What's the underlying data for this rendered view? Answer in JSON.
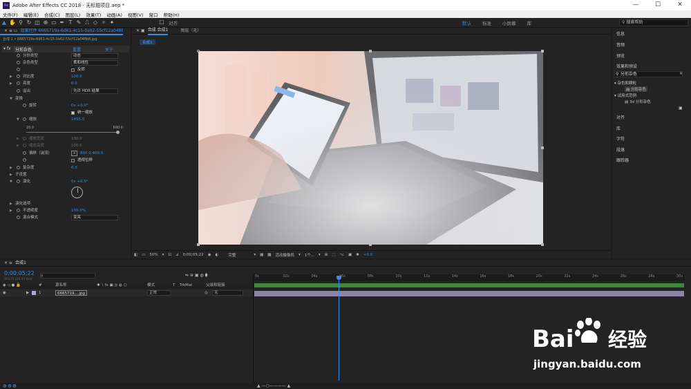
{
  "app": {
    "title": "Adobe After Effects CC 2018 - 无标题项目.aep *",
    "logo": "Ae"
  },
  "window_controls": [
    "—",
    "☐",
    "✕"
  ],
  "menu": [
    "文件(F)",
    "编辑(E)",
    "合成(C)",
    "图层(L)",
    "效果(T)",
    "动画(A)",
    "视图(V)",
    "窗口",
    "帮助(H)"
  ],
  "toolbar": {
    "snap_label": "对齐",
    "workspaces": [
      "默认",
      "标准",
      "小屏幕",
      "库"
    ],
    "active_workspace": "默认",
    "search_placeholder": "搜索帮助"
  },
  "effects_panel": {
    "tab": "效果控件 6665719a-6d61-4c15-0a62-55cf12a048b6.jpg",
    "breadcrumb": "合成 1 • 6665719a-6d61-4c15-0a62-55cf12a048b6.jpg",
    "effect_name": "分形杂色",
    "reset": "重置",
    "about": "关于",
    "props": [
      {
        "label": "分形类型",
        "value": "动态",
        "kind": "dd"
      },
      {
        "label": "杂色类型",
        "value": "柔和线性",
        "kind": "dd"
      },
      {
        "label": "",
        "value": "反转",
        "kind": "cb"
      },
      {
        "label": "对比度",
        "value": "100.0",
        "kind": "num"
      },
      {
        "label": "亮度",
        "value": "0.0",
        "kind": "num"
      },
      {
        "label": "溢出",
        "value": "允许 HDR 结果",
        "kind": "dd"
      },
      {
        "label": "变换",
        "value": "",
        "kind": "group"
      },
      {
        "label": "旋转",
        "value": "0x +0.0°",
        "kind": "num"
      },
      {
        "label": "",
        "value": "统一缩放",
        "kind": "cb"
      },
      {
        "label": "缩放",
        "value": "1455.0",
        "kind": "num"
      },
      {
        "label": "缩放宽度",
        "value": "100.0",
        "kind": "dim"
      },
      {
        "label": "缩放高度",
        "value": "100.0",
        "kind": "dim"
      },
      {
        "label": "偏移（湍流）",
        "value": "800.0,400.0",
        "kind": "num"
      },
      {
        "label": "",
        "value": "透视位移",
        "kind": "cb"
      },
      {
        "label": "复杂度",
        "value": "6.0",
        "kind": "num"
      },
      {
        "label": "子设置",
        "value": "",
        "kind": "group"
      },
      {
        "label": "演化",
        "value": "0x +0.0°",
        "kind": "num"
      },
      {
        "label": "演化选项",
        "value": "",
        "kind": "group"
      },
      {
        "label": "不透明度",
        "value": "100.0%",
        "kind": "num"
      },
      {
        "label": "混合模式",
        "value": "变亮",
        "kind": "dd"
      }
    ],
    "slider_min": "20.0",
    "slider_max": "600.0"
  },
  "viewer": {
    "tab": "合成 合成1",
    "layer_tab": "图层（无）",
    "comp_chip": "合成1",
    "zoom": "50%",
    "timecode": "0;00;05;22",
    "quality": "完整",
    "camera": "活动摄像机",
    "views": "1个...",
    "exposure": "+0.0"
  },
  "right_panel": {
    "items": [
      "信息",
      "音频",
      "预览",
      "效果和预设"
    ],
    "search": "分形杂色",
    "tree": [
      {
        "label": "杂色和颗粒",
        "open": true
      },
      {
        "label": "分形杂色",
        "leaf": true
      },
      {
        "label": "试用式范例",
        "open": true
      },
      {
        "label": "3d 分形杂色",
        "leaf": true
      }
    ],
    "lower": [
      "对齐",
      "库",
      "字符",
      "段落",
      "跟踪器"
    ]
  },
  "timeline": {
    "tab": "合成1",
    "timecode": "0;00;05;22",
    "fps": "00172 (29.97 fps)",
    "columns": [
      "源名称",
      "模式",
      "T",
      "TrkMat",
      "父级和链接"
    ],
    "layer": {
      "index": "1",
      "name": "6665719....jpg",
      "mode": "正常",
      "parent": "无"
    },
    "ticks": [
      "0s",
      "02s",
      "04s",
      "06s",
      "08s",
      "10s",
      "12s",
      "14s",
      "16s",
      "18s",
      "20s",
      "22s",
      "24s",
      "26s",
      "28s",
      "30s"
    ],
    "playhead": 0.195
  },
  "watermark": {
    "text1": "Bai",
    "text2": "经验",
    "url": "jingyan.baidu.com"
  }
}
